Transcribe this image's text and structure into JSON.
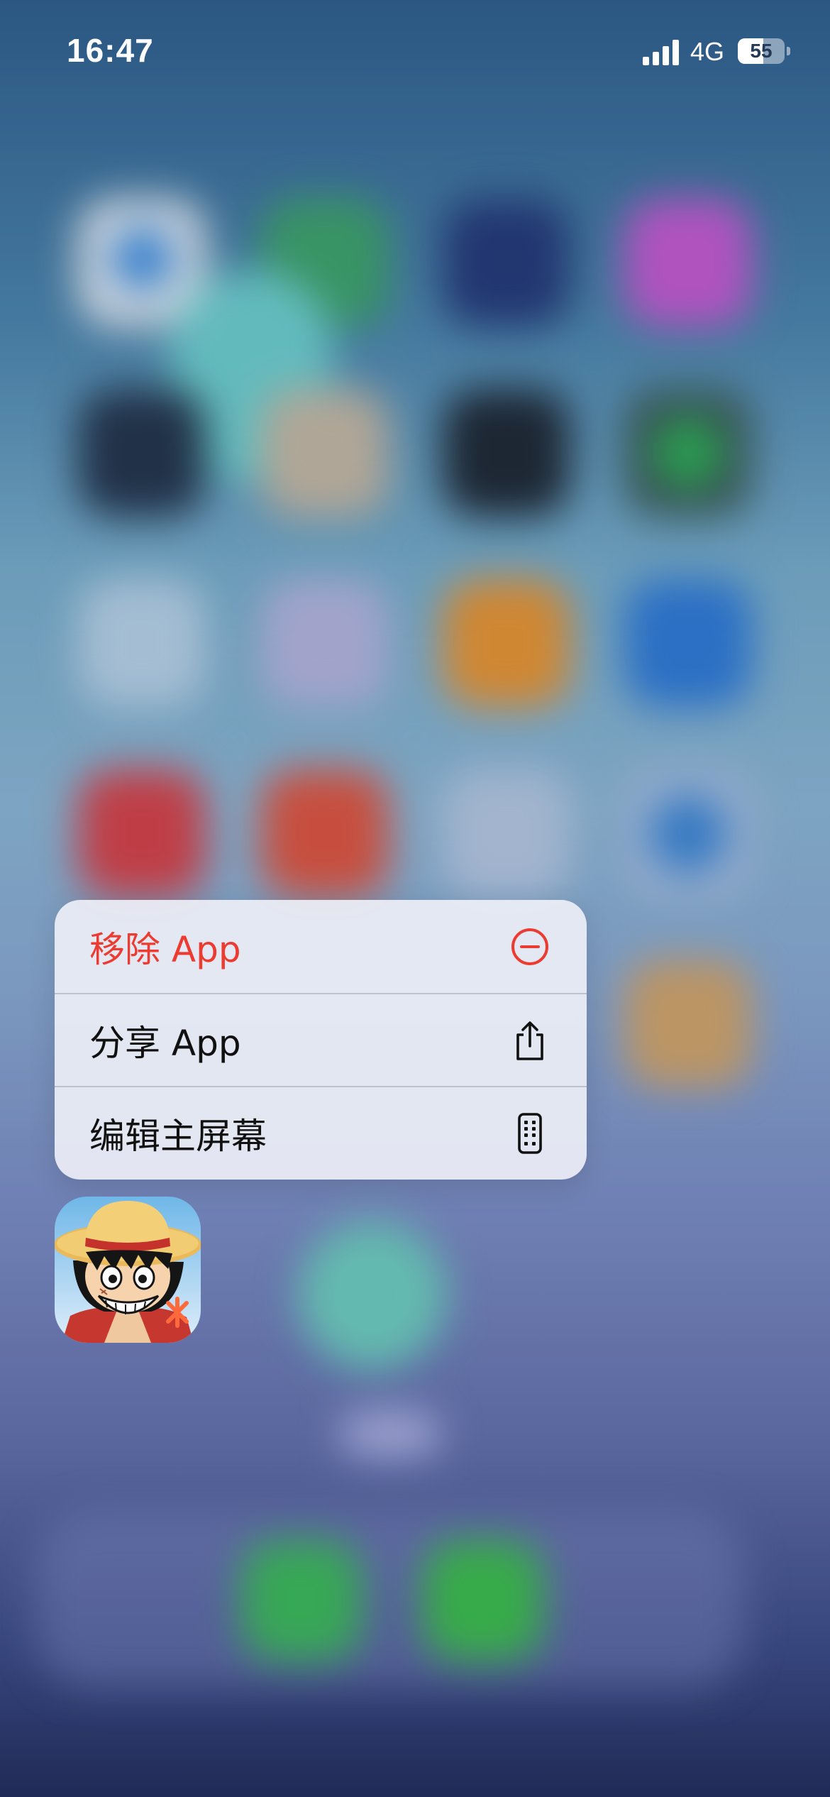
{
  "status_bar": {
    "time": "16:47",
    "network": "4G",
    "battery": "55",
    "battery_level_percent": 55,
    "signal_bars": 4
  },
  "context_menu": {
    "items": [
      {
        "label": "移除 App",
        "icon": "minus-circle-icon",
        "style": "destructive",
        "color": "#ec3b30"
      },
      {
        "label": "分享 App",
        "icon": "share-icon",
        "style": "default",
        "color": "#111111"
      },
      {
        "label": "编辑主屏幕",
        "icon": "phone-edit-icon",
        "style": "default",
        "color": "#111111"
      }
    ]
  },
  "selected_app": {
    "icon": "one-piece-luffy-app-icon"
  }
}
